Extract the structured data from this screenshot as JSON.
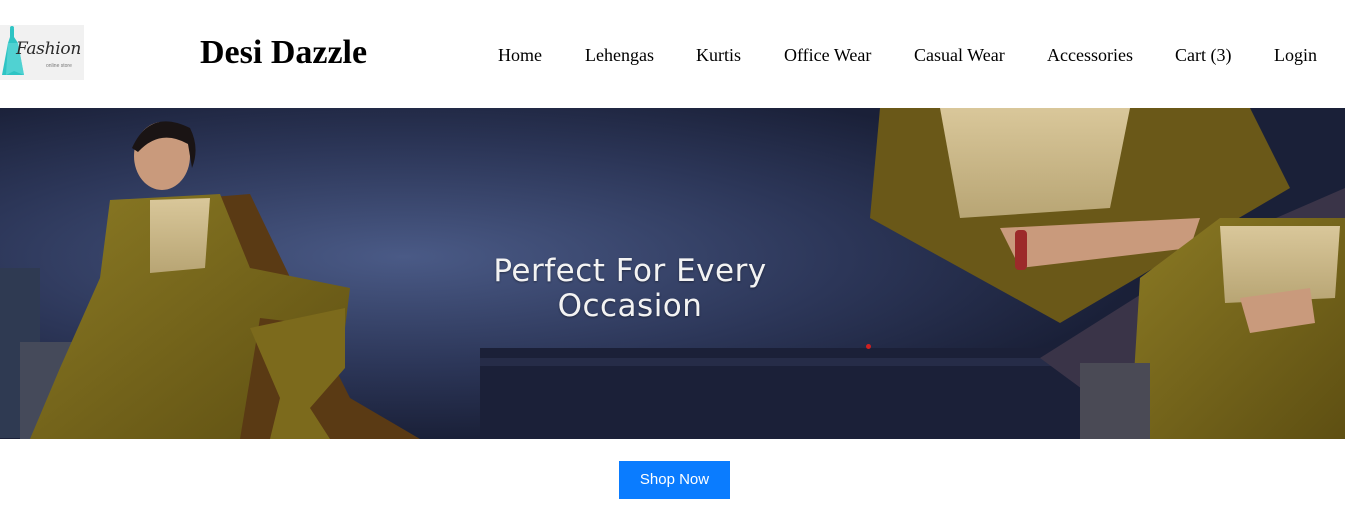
{
  "logo": {
    "text": "Fashion",
    "subtext": "online store",
    "icon": "dress-icon",
    "accent_color": "#2ec4c4"
  },
  "brand": {
    "name": "Desi Dazzle"
  },
  "nav": {
    "items": [
      {
        "label": "Home"
      },
      {
        "label": "Lehengas"
      },
      {
        "label": "Kurtis"
      },
      {
        "label": "Office Wear"
      },
      {
        "label": "Casual Wear"
      },
      {
        "label": "Accessories"
      },
      {
        "label": "Cart (3)"
      },
      {
        "label": "Login"
      }
    ]
  },
  "hero": {
    "title_line1": "Perfect For Every",
    "title_line2": "Occasion",
    "background_color": "#1d2440",
    "outfit_color": "#7a6a1a"
  },
  "cta": {
    "label": "Shop Now",
    "color": "#0a7cff"
  }
}
